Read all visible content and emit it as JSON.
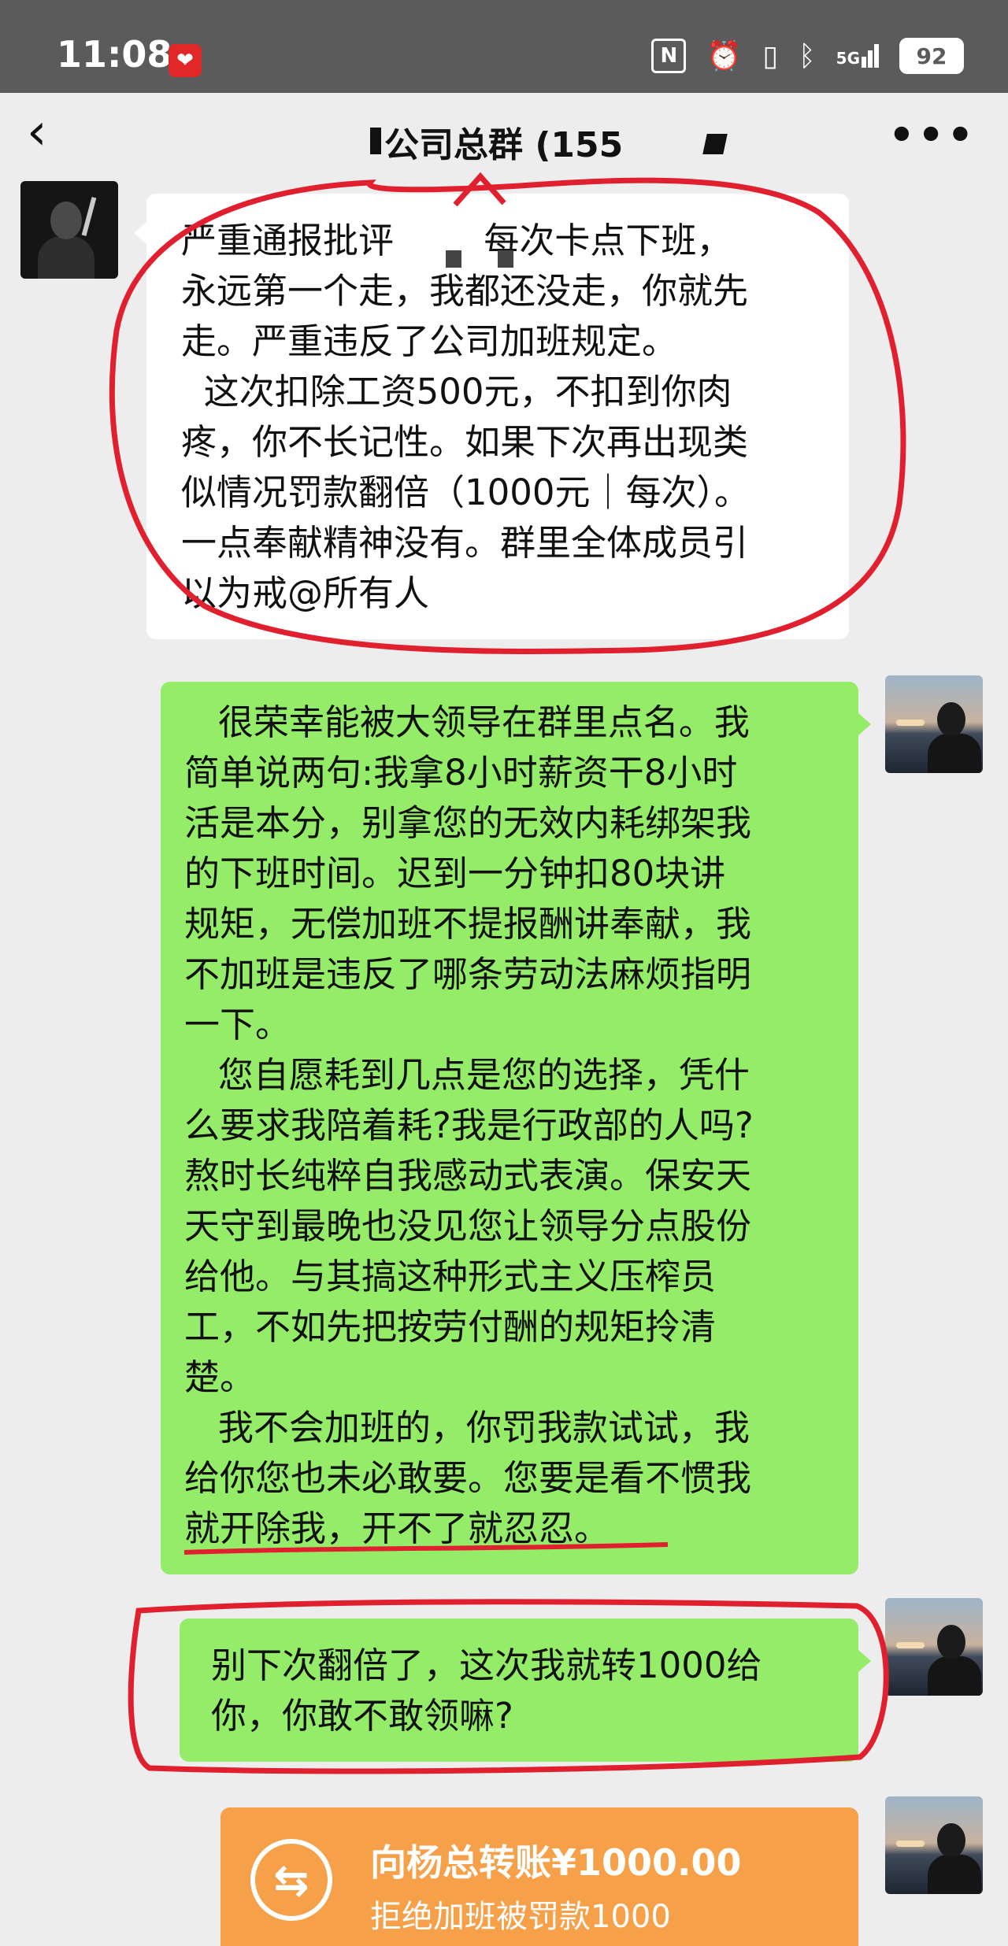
{
  "status_bar": {
    "time": "11:08",
    "app_badge": "❤",
    "signal_label": "5G",
    "battery": "92"
  },
  "header": {
    "back_label": "‹",
    "title": "公司总群 (155",
    "more_label": "•••"
  },
  "messages": {
    "boss": {
      "text": "严重通报批评        每次卡点下班，\n永远第一个走，我都还没走，你就先\n走。严重违反了公司加班规定。\n  这次扣除工资500元，不扣到你肉\n疼，你不长记性。如果下次再出现类\n似情况罚款翻倍（1000元｜每次）。\n一点奉献精神没有。群里全体成员引\n以为戒@所有人"
    },
    "reply": {
      "text": "   很荣幸能被大领导在群里点名。我\n简单说两句:我拿8小时薪资干8小时\n活是本分，别拿您的无效内耗绑架我\n的下班时间。迟到一分钟扣80块讲\n规矩，无偿加班不提报酬讲奉献，我\n不加班是违反了哪条劳动法麻烦指明\n一下。\n   您自愿耗到几点是您的选择，凭什\n么要求我陪着耗?我是行政部的人吗?\n熬时长纯粹自我感动式表演。保安天\n天守到最晚也没见您让领导分点股份\n给他。与其搞这种形式主义压榨员\n工，不如先把按劳付酬的规矩拎清\n楚。\n   我不会加班的，你罚我款试试，我\n给你您也未必敢要。您要是看不惯我\n就开除我，开不了就忍忍。"
    },
    "reply2": {
      "text": "别下次翻倍了，这次我就转1000给\n你，你敢不敢领嘛?"
    },
    "transfer": {
      "icon": "⇆",
      "amount": "向杨总转账¥1000.00",
      "note": "拒绝加班被罚款1000"
    }
  },
  "colors": {
    "status_bar": "#5b5b5b",
    "chat_background": "#ededed",
    "my_bubble": "#95ec69",
    "other_bubble": "#ffffff",
    "transfer_card": "#f6a04a",
    "annotation_red": "#e0202e"
  }
}
